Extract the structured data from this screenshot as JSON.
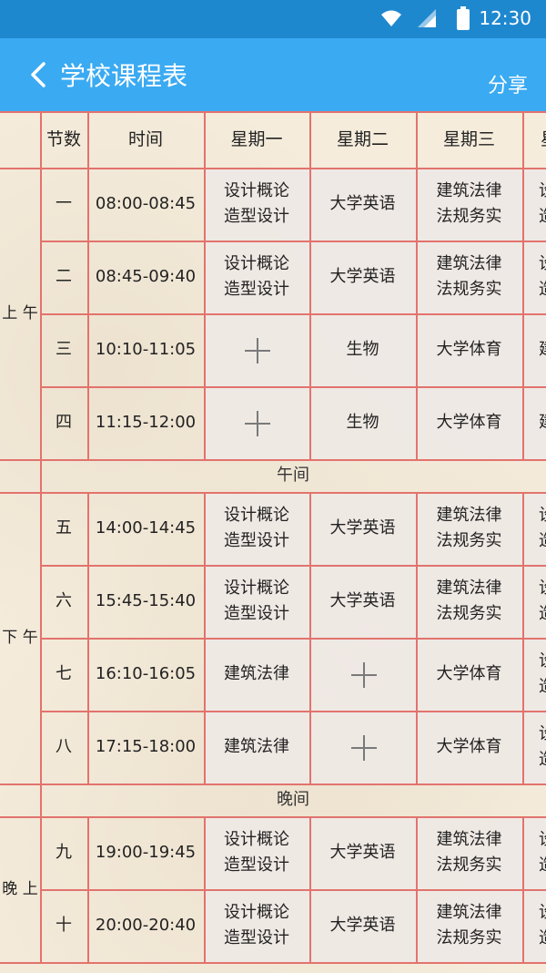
{
  "status_bar": {
    "time": "12:30",
    "icons": [
      "wifi-icon",
      "signal-icon",
      "battery-icon"
    ]
  },
  "app_bar": {
    "title": "学校课程表",
    "share_label": "分享",
    "back_icon": "chevron-left-icon"
  },
  "colors": {
    "app_bar": "#3aaaf2",
    "status_bar": "#1e88cf",
    "grid_line": "#e2736d",
    "background": "#f5ecdc"
  },
  "table": {
    "headers": [
      "节数",
      "时间",
      "星期一",
      "星期二",
      "星期三"
    ],
    "periods": {
      "morning": "上\n午",
      "afternoon": "下\n午",
      "evening": "晚\n上"
    },
    "breaks": {
      "noon": "午间",
      "evening": "晚间"
    },
    "rows": [
      {
        "num": "一",
        "time": "08:00-08:45",
        "mon": "设计概论\n造型设计",
        "tue": "大学英语",
        "wed": "建筑法律\n法规务实"
      },
      {
        "num": "二",
        "time": "08:45-09:40",
        "mon": "设计概论\n造型设计",
        "tue": "大学英语",
        "wed": "建筑法律\n法规务实"
      },
      {
        "num": "三",
        "time": "10:10-11:05",
        "mon": "",
        "tue": "生物",
        "wed": "大学体育"
      },
      {
        "num": "四",
        "time": "11:15-12:00",
        "mon": "",
        "tue": "生物",
        "wed": "大学体育"
      },
      {
        "num": "五",
        "time": "14:00-14:45",
        "mon": "设计概论\n造型设计",
        "tue": "大学英语",
        "wed": "建筑法律\n法规务实"
      },
      {
        "num": "六",
        "time": "15:45-15:40",
        "mon": "设计概论\n造型设计",
        "tue": "大学英语",
        "wed": "建筑法律\n法规务实"
      },
      {
        "num": "七",
        "time": "16:10-16:05",
        "mon": "建筑法律",
        "tue": "",
        "wed": "大学体育"
      },
      {
        "num": "八",
        "time": "17:15-18:00",
        "mon": "建筑法律",
        "tue": "",
        "wed": "大学体育"
      },
      {
        "num": "九",
        "time": "19:00-19:45",
        "mon": "设计概论\n造型设计",
        "tue": "大学英语",
        "wed": "建筑法律\n法规务实"
      },
      {
        "num": "十",
        "time": "20:00-20:40",
        "mon": "设计概论\n造型设计",
        "tue": "大学英语",
        "wed": "建筑法律\n法规务实"
      }
    ],
    "thursday_partial": [
      "设\n造",
      "设\n造",
      "建",
      "建",
      "设\n造",
      "设\n造",
      "设\n造",
      "设\n造",
      "设\n造",
      "设\n造"
    ],
    "thursday_header_partial": "星"
  }
}
